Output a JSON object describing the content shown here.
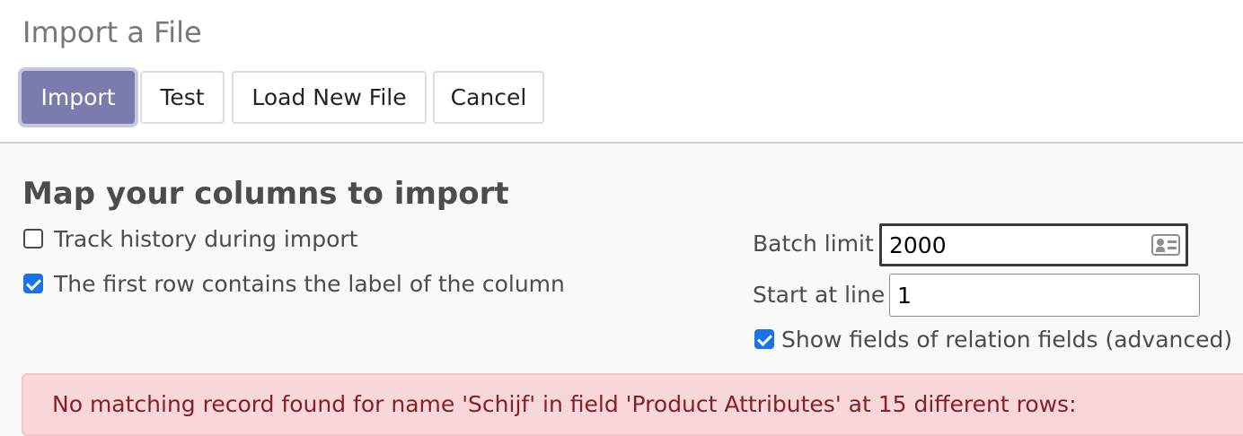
{
  "page": {
    "title": "Import a File"
  },
  "toolbar": {
    "import_label": "Import",
    "test_label": "Test",
    "load_new_file_label": "Load New File",
    "cancel_label": "Cancel"
  },
  "mapping": {
    "title": "Map your columns to import",
    "options": {
      "track_history": {
        "label": "Track history during import",
        "checked": false
      },
      "first_row_header": {
        "label": "The first row contains the label of the column",
        "checked": true
      }
    },
    "batch_limit": {
      "label": "Batch limit",
      "value": "2000"
    },
    "start_at_line": {
      "label": "Start at line",
      "value": "1"
    },
    "show_relation_fields": {
      "label": "Show fields of relation fields (advanced)",
      "checked": true
    }
  },
  "alert": {
    "message": "No matching record found for name 'Schijf' in field 'Product Attributes' at 15 different rows:"
  },
  "icons": {
    "batch_limit_icon": "contact-card-icon"
  },
  "colors": {
    "primary": "#7c7bad",
    "checkbox_checked": "#1a73e8",
    "alert_background": "#f8d7da",
    "alert_text": "#842029"
  }
}
